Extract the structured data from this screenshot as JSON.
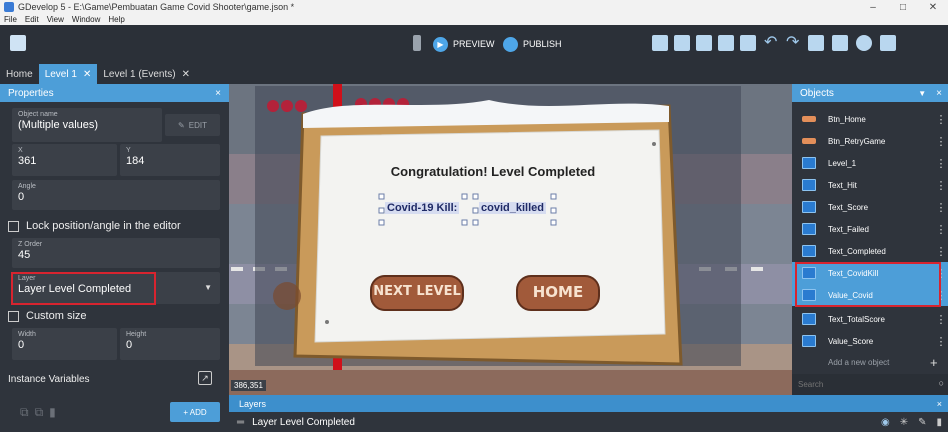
{
  "window": {
    "title": "GDevelop 5 - E:\\Game\\Pembuatan Game Covid Shooter\\game.json *",
    "controls": [
      "–",
      "□",
      "✕"
    ]
  },
  "menu": [
    "File",
    "Edit",
    "View",
    "Window",
    "Help"
  ],
  "toolbar": {
    "preview_label": "PREVIEW",
    "publish_label": "PUBLISH"
  },
  "tabs": [
    {
      "label": "Home"
    },
    {
      "label": "Level 1",
      "close": "✕"
    },
    {
      "label": "Level 1 (Events)",
      "close": "✕"
    }
  ],
  "properties": {
    "title": "Properties",
    "close": "×",
    "object_name_label": "Object name",
    "object_name_value": "(Multiple values)",
    "edit_label": "EDIT",
    "x_label": "X",
    "x_value": "361",
    "y_label": "Y",
    "y_value": "184",
    "angle_label": "Angle",
    "angle_value": "0",
    "lock_label": "Lock position/angle in the editor",
    "zorder_label": "Z Order",
    "zorder_value": "45",
    "layer_label": "Layer",
    "layer_value": "Layer Level Completed",
    "custom_size_label": "Custom size",
    "width_label": "Width",
    "width_value": "0",
    "height_label": "Height",
    "height_value": "0",
    "instance_vars_label": "Instance Variables",
    "add_label": "+ ADD"
  },
  "canvas": {
    "congrats_text": "Congratulation! Level Completed",
    "kill_label": "Covid-19 Kill:",
    "kill_value": "covid_killed",
    "next_level": "NEXT LEVEL",
    "home": "HOME",
    "coords": "386,351"
  },
  "objects": {
    "title": "Objects",
    "items": [
      {
        "name": "Btn_Home",
        "icon": "button-sprite-icon"
      },
      {
        "name": "Btn_RetryGame",
        "icon": "button-sprite-icon"
      },
      {
        "name": "Level_1",
        "icon": "text-object-icon"
      },
      {
        "name": "Text_Hit",
        "icon": "text-object-icon"
      },
      {
        "name": "Text_Score",
        "icon": "text-object-icon"
      },
      {
        "name": "Text_Failed",
        "icon": "text-object-icon"
      },
      {
        "name": "Text_Completed",
        "icon": "text-object-icon"
      },
      {
        "name": "Text_CovidKill",
        "icon": "text-object-icon"
      },
      {
        "name": "Value_Covid",
        "icon": "text-object-icon"
      },
      {
        "name": "Text_TotalScore",
        "icon": "text-object-icon"
      },
      {
        "name": "Value_Score",
        "icon": "text-object-icon"
      }
    ],
    "add_new_label": "Add a new object",
    "search_placeholder": "Search"
  },
  "layers": {
    "title": "Layers",
    "row_label": "Layer Level Completed"
  },
  "colors": {
    "accent": "#4d9ed8",
    "highlight_box": "#d8242f",
    "panel_bg": "#2f343c",
    "wood": "#c99a5a",
    "button_brown": "#a15a3a"
  }
}
